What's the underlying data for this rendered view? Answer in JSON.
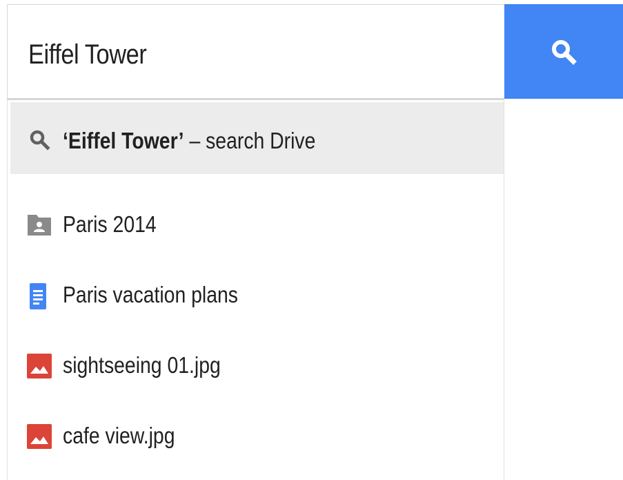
{
  "search": {
    "query": "Eiffel Tower",
    "button_icon": "search-icon",
    "button_color": "#4285f4"
  },
  "suggestion": {
    "icon": "search-icon",
    "query_quoted": "‘Eiffel Tower’",
    "suffix": " – search Drive"
  },
  "results": [
    {
      "icon": "shared-folder-icon",
      "label": "Paris 2014",
      "color": "#8a8a8a"
    },
    {
      "icon": "google-docs-icon",
      "label": "Paris vacation plans",
      "color": "#4285f4"
    },
    {
      "icon": "image-file-icon",
      "label": "sightseeing 01.jpg",
      "color": "#db4437"
    },
    {
      "icon": "image-file-icon",
      "label": "cafe view.jpg",
      "color": "#db4437"
    }
  ]
}
